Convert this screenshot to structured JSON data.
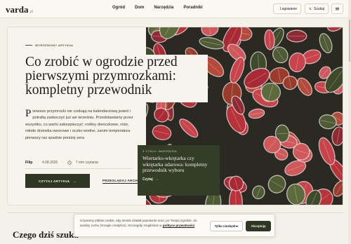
{
  "header": {
    "logo": "varda",
    "logo_tld": ".pl",
    "nav": [
      "Ogród",
      "Dom",
      "Narzędzia",
      "Poradniki"
    ],
    "login_label": "Logowanie",
    "search_label": "Szukaj"
  },
  "hero": {
    "eyebrow": "WYRÓŻNIONY ARTYKUŁ",
    "title": "Co zrobić w ogrodzie przed pierwszymi przymrozkami: kompletny przewodnik",
    "lede_dropcap": "P",
    "lede": "ierwsze przymrozki nie czekają na kalendarzową jesień i potrafią zaskoczyć już we wrześniu. Przedstawiamy przez wszystko, co warto zabezpieczyć: rośliny doniczkowe, róże, młode drzewka owocowe i oczko wodne, zanim temperatura pierwszy raz spadnie poniżej zera",
    "author": "Filip",
    "date": "4.08.2026",
    "read_time": "7 min czytania",
    "read_button": "CZYTAJ ARTYKUŁ",
    "archive_button": "PRZEGLĄDAJ ARCHIWUM",
    "image_alt": "frost-covered-red-leaves"
  },
  "cycle": {
    "tag": "Z CYKLU: NARZĘDZIA",
    "title": "Wiertarko-wkrętarka czy wkrętarka udarowa: kompletny przewodnik wyboru",
    "link": "Czytaj"
  },
  "section": {
    "heading": "Czego dziś szuka"
  },
  "cookie": {
    "text": "Używamy plików cookie, aby serwis działał poprawnie oraz, po Twojej zgodzie, do analizy ruchu (Google Analytics). Szczegóły znajdziesz w",
    "policy_link": "polityce prywatności",
    "necessary_button": "Tylko niezbędne",
    "accept_button": "Akceptuję"
  },
  "colors": {
    "accent_dark": "#2f3623",
    "cycle_card": "#343d27",
    "page_bg": "#f4f1ea"
  }
}
